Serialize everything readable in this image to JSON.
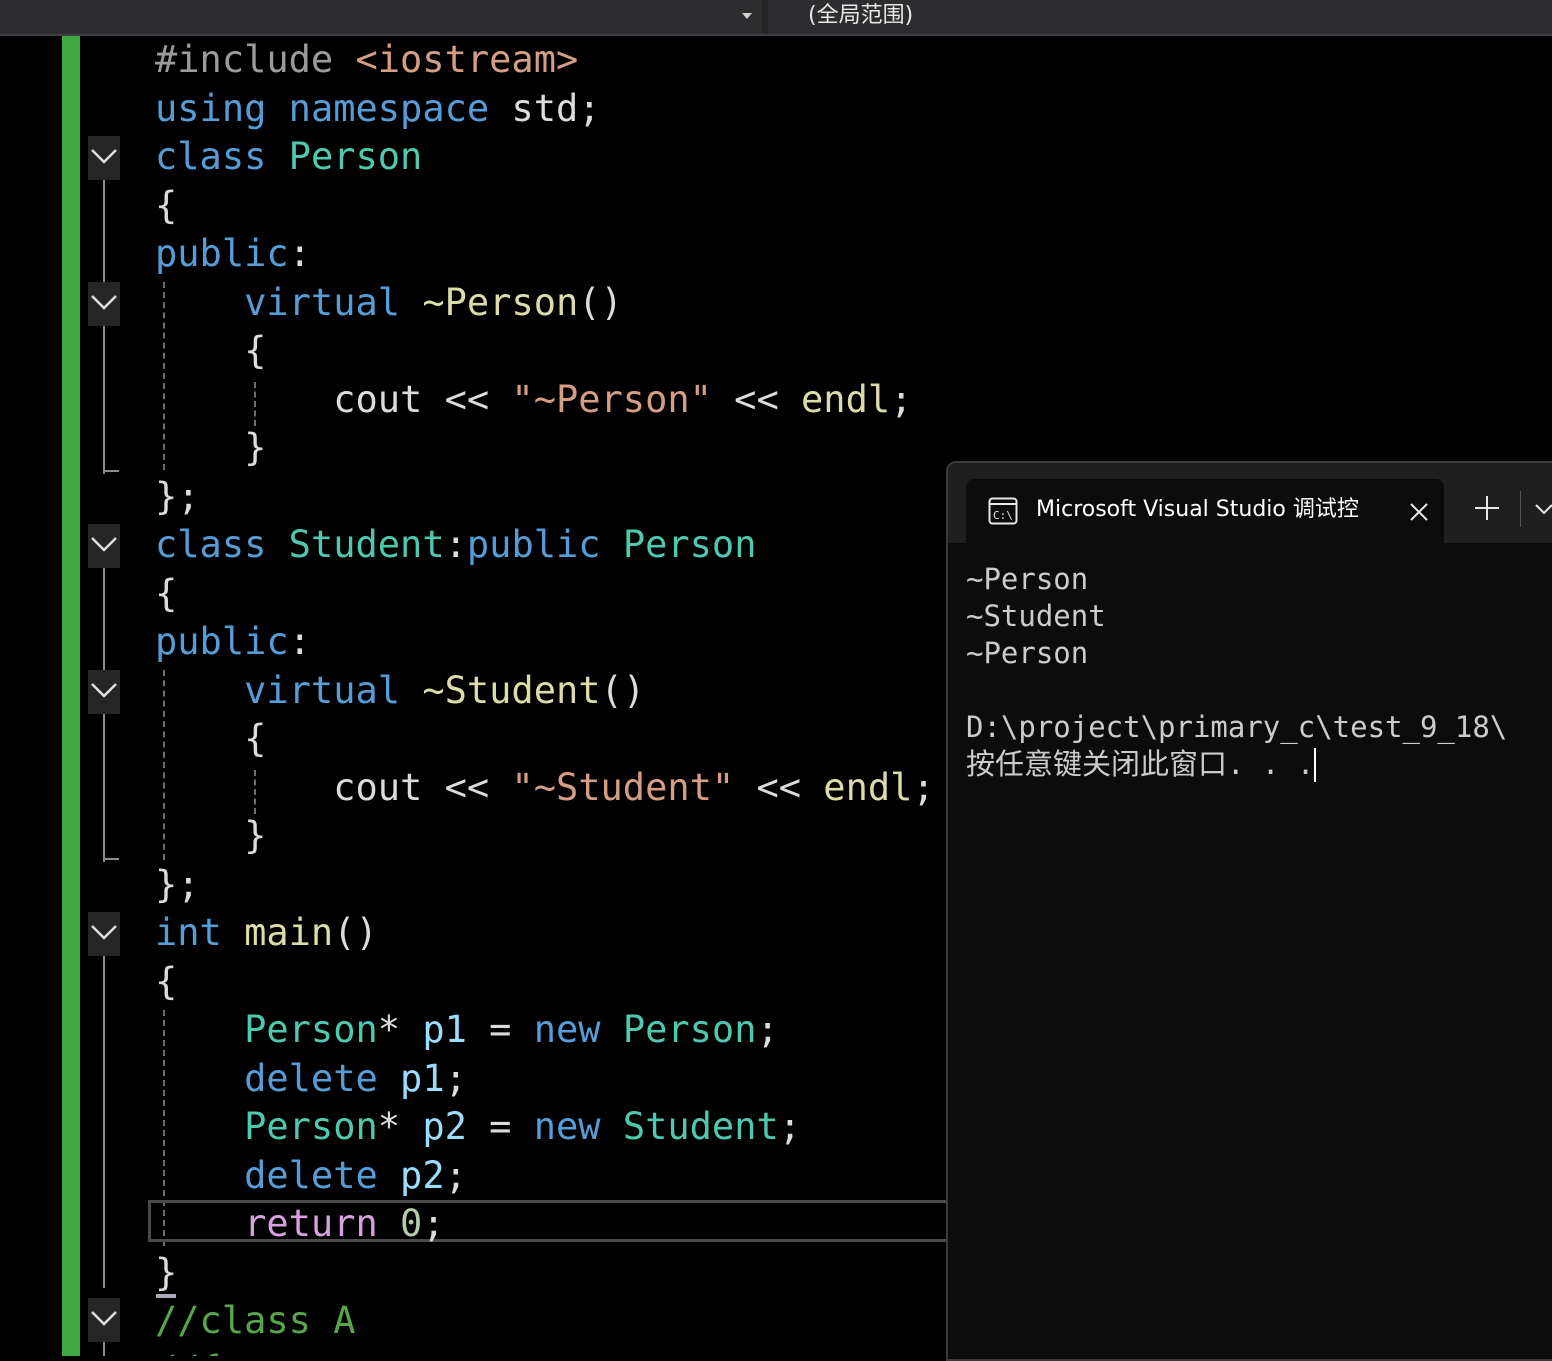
{
  "top_bar": {
    "scope_label": "(全局范围)"
  },
  "editor": {
    "lines": [
      {
        "tokens": [
          [
            "inc",
            "#include "
          ],
          [
            "str",
            "<iostream>"
          ]
        ]
      },
      {
        "tokens": [
          [
            "kw",
            "using"
          ],
          [
            "pl",
            " "
          ],
          [
            "kw",
            "namespace"
          ],
          [
            "pl",
            " std;"
          ]
        ]
      },
      {
        "tokens": [
          [
            "kw",
            "class"
          ],
          [
            "pl",
            " "
          ],
          [
            "ty",
            "Person"
          ]
        ]
      },
      {
        "tokens": [
          [
            "pl",
            "{"
          ]
        ]
      },
      {
        "tokens": [
          [
            "kw",
            "public"
          ],
          [
            "pl",
            ":"
          ]
        ]
      },
      {
        "tokens": [
          [
            "pl",
            "    "
          ],
          [
            "kw",
            "virtual"
          ],
          [
            "pl",
            " "
          ],
          [
            "fn",
            "~Person"
          ],
          [
            "pl",
            "()"
          ]
        ]
      },
      {
        "tokens": [
          [
            "pl",
            "    {"
          ]
        ]
      },
      {
        "tokens": [
          [
            "pl",
            "        cout << "
          ],
          [
            "str",
            "\"~Person\""
          ],
          [
            "pl",
            " << "
          ],
          [
            "fn",
            "endl"
          ],
          [
            "pl",
            ";"
          ]
        ]
      },
      {
        "tokens": [
          [
            "pl",
            "    }"
          ]
        ]
      },
      {
        "tokens": [
          [
            "pl",
            "};"
          ]
        ]
      },
      {
        "tokens": [
          [
            "kw",
            "class"
          ],
          [
            "pl",
            " "
          ],
          [
            "ty",
            "Student"
          ],
          [
            "pl",
            ":"
          ],
          [
            "kw",
            "public"
          ],
          [
            "pl",
            " "
          ],
          [
            "ty",
            "Person"
          ]
        ]
      },
      {
        "tokens": [
          [
            "pl",
            "{"
          ]
        ]
      },
      {
        "tokens": [
          [
            "kw",
            "public"
          ],
          [
            "pl",
            ":"
          ]
        ]
      },
      {
        "tokens": [
          [
            "pl",
            "    "
          ],
          [
            "kw",
            "virtual"
          ],
          [
            "pl",
            " "
          ],
          [
            "fn",
            "~Student"
          ],
          [
            "pl",
            "()"
          ]
        ]
      },
      {
        "tokens": [
          [
            "pl",
            "    {"
          ]
        ]
      },
      {
        "tokens": [
          [
            "pl",
            "        cout << "
          ],
          [
            "str",
            "\"~Student\""
          ],
          [
            "pl",
            " << "
          ],
          [
            "fn",
            "endl"
          ],
          [
            "pl",
            ";"
          ]
        ]
      },
      {
        "tokens": [
          [
            "pl",
            "    }"
          ]
        ]
      },
      {
        "tokens": [
          [
            "pl",
            "};"
          ]
        ]
      },
      {
        "tokens": [
          [
            "kw",
            "int"
          ],
          [
            "pl",
            " "
          ],
          [
            "fn",
            "main"
          ],
          [
            "pl",
            "()"
          ]
        ]
      },
      {
        "tokens": [
          [
            "pl",
            "{"
          ]
        ]
      },
      {
        "tokens": [
          [
            "pl",
            "    "
          ],
          [
            "ty",
            "Person"
          ],
          [
            "pl",
            "* "
          ],
          [
            "var",
            "p1"
          ],
          [
            "pl",
            " = "
          ],
          [
            "kw",
            "new"
          ],
          [
            "pl",
            " "
          ],
          [
            "ty",
            "Person"
          ],
          [
            "pl",
            ";"
          ]
        ]
      },
      {
        "tokens": [
          [
            "pl",
            "    "
          ],
          [
            "kw",
            "delete"
          ],
          [
            "pl",
            " "
          ],
          [
            "var",
            "p1"
          ],
          [
            "pl",
            ";"
          ]
        ]
      },
      {
        "tokens": [
          [
            "pl",
            "    "
          ],
          [
            "ty",
            "Person"
          ],
          [
            "pl",
            "* "
          ],
          [
            "var",
            "p2"
          ],
          [
            "pl",
            " = "
          ],
          [
            "kw",
            "new"
          ],
          [
            "pl",
            " "
          ],
          [
            "ty",
            "Student"
          ],
          [
            "pl",
            ";"
          ]
        ]
      },
      {
        "tokens": [
          [
            "pl",
            "    "
          ],
          [
            "kw",
            "delete"
          ],
          [
            "pl",
            " "
          ],
          [
            "var",
            "p2"
          ],
          [
            "pl",
            ";"
          ]
        ]
      },
      {
        "tokens": [
          [
            "pl",
            "    "
          ],
          [
            "ctl",
            "return"
          ],
          [
            "pl",
            " "
          ],
          [
            "num",
            "0"
          ],
          [
            "pl",
            ";"
          ]
        ]
      },
      {
        "tokens": [
          [
            "pl",
            "}"
          ]
        ]
      },
      {
        "tokens": [
          [
            "cm",
            "//class A"
          ]
        ]
      },
      {
        "tokens": [
          [
            "cm",
            "//{ "
          ]
        ]
      }
    ]
  },
  "console": {
    "tab_title": "Microsoft Visual Studio 调试控",
    "tab_icon": "terminal-icon",
    "output": [
      "~Person",
      "~Student",
      "~Person",
      "",
      "D:\\project\\primary_c\\test_9_18\\",
      "按任意键关闭此窗口. . ."
    ]
  },
  "colors": {
    "keyword": "#569cd6",
    "type": "#4ec9b0",
    "function": "#dcdcaa",
    "string": "#d69d85",
    "comment": "#57a64a",
    "change_bar": "#3fa83f"
  }
}
